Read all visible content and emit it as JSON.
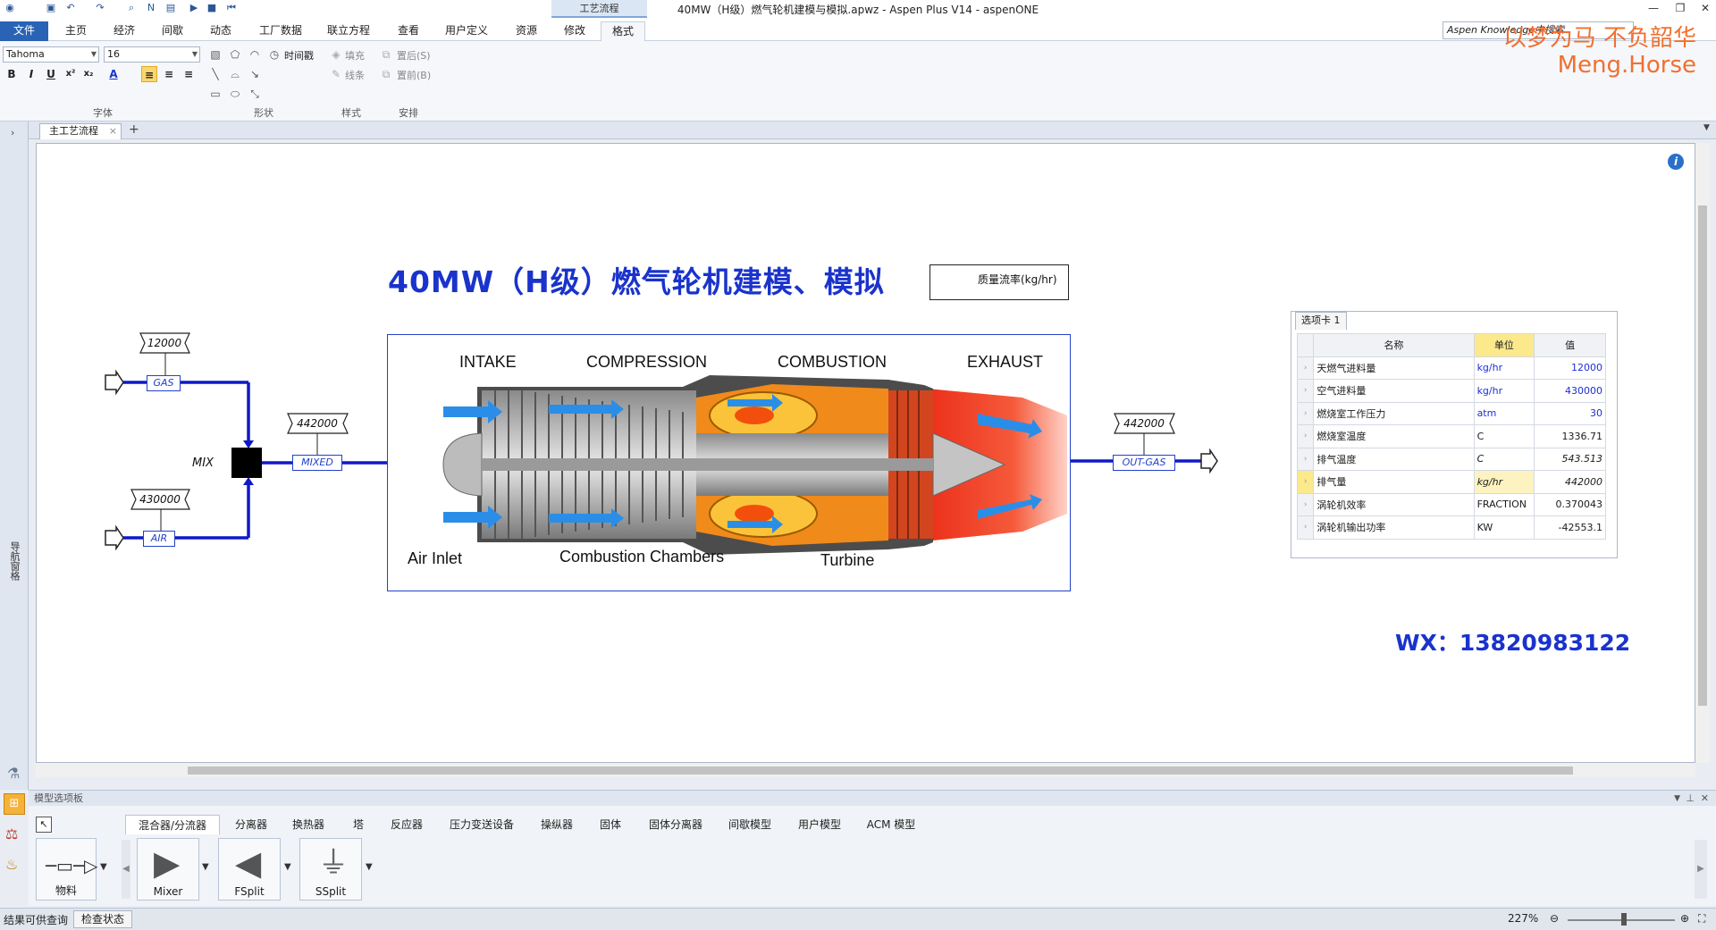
{
  "window": {
    "title": "40MW（H级）燃气轮机建模与模拟.apwz - Aspen Plus V14 - aspenONE",
    "context_tab_group": "工艺流程",
    "search_placeholder": "Aspen Knowledge中搜索"
  },
  "menu": {
    "tabs": [
      "文件",
      "主页",
      "经济",
      "间歇",
      "动态",
      "工厂数据",
      "联立方程",
      "查看",
      "用户定义",
      "资源",
      "修改",
      "格式"
    ],
    "active": "格式"
  },
  "ribbon": {
    "font_name": "Tahoma",
    "font_size": "16",
    "timestamp_label": "时间戳",
    "fill_label": "填充",
    "line_label": "线条",
    "bring_back_label": "置后(S)",
    "bring_front_label": "置前(B)",
    "groups": [
      "字体",
      "形状",
      "样式",
      "安排"
    ]
  },
  "doc_tab": {
    "label": "主工艺流程",
    "add": "+"
  },
  "left_nav": {
    "label": "导航窗格"
  },
  "flowsheet": {
    "title": "40MW（H级）燃气轮机建模、模拟",
    "legend_label": "质量流率(kg/hr)",
    "mix_label": "MIX",
    "streams": {
      "gas": {
        "name": "GAS",
        "flow": "12000"
      },
      "air": {
        "name": "AIR",
        "flow": "430000"
      },
      "mixed": {
        "name": "MIXED",
        "flow": "442000"
      },
      "out_gas": {
        "name": "OUT-GAS",
        "flow": "442000"
      }
    },
    "engine_labels": {
      "intake": "INTAKE",
      "compression": "COMPRESSION",
      "combustion": "COMBUSTION",
      "exhaust": "EXHAUST",
      "air_inlet": "Air Inlet",
      "chambers": "Combustion Chambers",
      "turbine": "Turbine"
    },
    "contact": "WX：13820983122"
  },
  "results_table": {
    "tab": "选项卡 1",
    "headers": {
      "name": "名称",
      "unit": "单位",
      "value": "值"
    },
    "rows": [
      {
        "name": "天燃气进料量",
        "unit": "kg/hr",
        "value": "12000"
      },
      {
        "name": "空气进料量",
        "unit": "kg/hr",
        "value": "430000"
      },
      {
        "name": "燃烧室工作压力",
        "unit": "atm",
        "value": "30"
      },
      {
        "name": "燃烧室温度",
        "unit": "C",
        "value": "1336.71"
      },
      {
        "name": "排气温度",
        "unit": "C",
        "value": "543.513"
      },
      {
        "name": "排气量",
        "unit": "kg/hr",
        "value": "442000"
      },
      {
        "name": "涡轮机效率",
        "unit": "FRACTION",
        "value": "0.370043"
      },
      {
        "name": "涡轮机输出功率",
        "unit": "KW",
        "value": "-42553.1"
      }
    ]
  },
  "watermark": {
    "line1": "以梦为马 不负韶华",
    "line2": "Meng.Horse"
  },
  "palette": {
    "header": "模型选项板",
    "tabs": [
      "混合器/分流器",
      "分离器",
      "换热器",
      "塔",
      "反应器",
      "压力变送设备",
      "操纵器",
      "固体",
      "固体分离器",
      "间歇模型",
      "用户模型",
      "ACM 模型"
    ],
    "active_tab": "混合器/分流器",
    "items": [
      "物料",
      "Mixer",
      "FSplit",
      "SSplit"
    ]
  },
  "status": {
    "left_text": "结果可供查询",
    "check_button": "检查状态",
    "zoom": "227%"
  }
}
